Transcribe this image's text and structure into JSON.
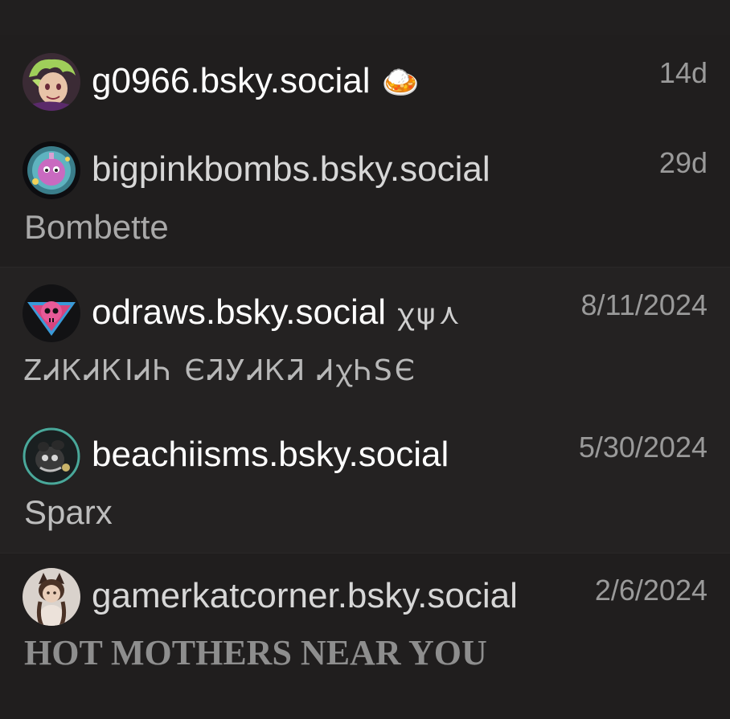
{
  "follows": [
    {
      "handle": "g0966.bsky.social",
      "handle_emoji": "🍛",
      "time": "14d",
      "display_name": "",
      "avatar_icon": "avatar-green-hair"
    },
    {
      "handle": "bigpinkbombs.bsky.social",
      "time": "29d",
      "display_name": "Bombette",
      "avatar_icon": "avatar-pink-bomb"
    },
    {
      "handle": "odraws.bsky.social",
      "handle_decoration": "ꭓψ⋏",
      "time": "8/11/2024",
      "display_name": "ᏃᏗᏦᏗᏦᏗᏂ ᏋᏘᎩᏗᏦᏘ ᏗᏕᏂᏕᏋ",
      "display_name_shown": "ᏃᏗᏦᏗᏦIᏗᏂ ЄᏘᎩᏗᏦᏘ ᏗꭓᏂSЄ",
      "avatar_icon": "avatar-pink-skull"
    },
    {
      "handle": "beachiisms.bsky.social",
      "time": "5/30/2024",
      "display_name": "Sparx",
      "avatar_icon": "avatar-dark-creature"
    },
    {
      "handle": "gamerkatcorner.bsky.social",
      "time": "2/6/2024",
      "display_name": "HOT MOTHERS NEAR YOU",
      "avatar_icon": "avatar-cat-girl"
    }
  ],
  "colors": {
    "background": "#211f1f",
    "handle_text": "#ffffff",
    "secondary_text": "#9a9a9a"
  }
}
